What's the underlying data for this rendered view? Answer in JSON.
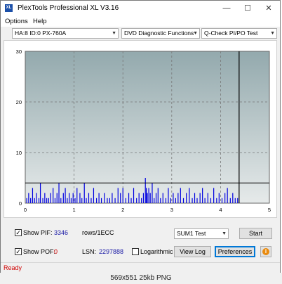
{
  "window": {
    "title": "PlexTools Professional XL V3.16",
    "icon_text": "XL",
    "minimize": "—",
    "maximize": "☐",
    "close": "✕"
  },
  "menu": {
    "options": "Options",
    "help": "Help"
  },
  "toolbar": {
    "drive": "HA:8 ID:0  PX-760A",
    "function": "DVD Diagnostic Functions",
    "test": "Q-Check PI/PO Test"
  },
  "chart_data": {
    "type": "bar",
    "xlim": [
      0,
      5
    ],
    "ylim": [
      0,
      30
    ],
    "x_ticks": [
      "0",
      "1",
      "2",
      "3",
      "4",
      "5"
    ],
    "y_ticks": [
      "0",
      "10",
      "20",
      "30"
    ],
    "threshold_y": 4,
    "end_marker_x": 4.38,
    "grid": true,
    "colors": {
      "bars": "#0000e0",
      "threshold": "#000000",
      "end_marker": "#000000"
    },
    "series": [
      {
        "x": [
          0.03,
          0.07,
          0.11,
          0.15,
          0.19,
          0.23,
          0.28,
          0.31,
          0.36,
          0.4,
          0.44,
          0.48,
          0.52,
          0.57,
          0.61,
          0.65,
          0.69,
          0.73,
          0.78,
          0.82,
          0.86,
          0.9,
          0.94,
          0.98,
          1.02,
          1.06,
          1.12,
          1.16,
          1.21,
          1.25,
          1.3,
          1.35,
          1.4,
          1.46,
          1.51,
          1.56,
          1.62,
          1.68,
          1.73,
          1.78,
          1.84,
          1.9,
          1.95,
          2.0,
          2.06,
          2.12,
          2.17,
          2.22,
          2.28,
          2.33,
          2.38,
          2.42,
          2.46,
          2.48,
          2.5,
          2.53,
          2.56,
          2.6,
          2.64,
          2.68,
          2.72,
          2.77,
          2.82,
          2.88,
          2.93,
          2.98,
          3.03,
          3.08,
          3.13,
          3.18,
          3.24,
          3.3,
          3.36,
          3.42,
          3.47,
          3.52,
          3.58,
          3.63,
          3.68,
          3.74,
          3.8,
          3.86,
          3.92,
          3.97,
          4.03,
          4.09,
          4.14,
          4.2,
          4.25,
          4.3,
          4.35
        ],
        "values": [
          1,
          2,
          1,
          3,
          1,
          2,
          1,
          4,
          1,
          2,
          1,
          1,
          2,
          3,
          1,
          2,
          4,
          1,
          2,
          3,
          1,
          2,
          1,
          2,
          1,
          3,
          2,
          1,
          4,
          1,
          2,
          1,
          3,
          1,
          2,
          1,
          2,
          1,
          1,
          2,
          1,
          3,
          2,
          3,
          1,
          2,
          1,
          3,
          1,
          2,
          1,
          2,
          5,
          3,
          2,
          3,
          2,
          4,
          1,
          2,
          3,
          1,
          2,
          1,
          3,
          1,
          2,
          1,
          2,
          3,
          1,
          2,
          3,
          1,
          2,
          1,
          2,
          3,
          1,
          2,
          1,
          3,
          1,
          2,
          1,
          2,
          3,
          1,
          2,
          1,
          1
        ]
      }
    ]
  },
  "controls": {
    "show_pif_label": "Show PIF:",
    "pif_value": "3346",
    "pif_unit": "rows/1ECC",
    "show_pof_label": "Show POF:",
    "pof_value": "0",
    "lsn_label": "LSN:",
    "lsn_value": "2297888",
    "logarithmic_label": "Logarithmic",
    "sum_select": "SUM1 Test",
    "start_button": "Start",
    "viewlog_button": "View Log",
    "preferences_button": "Preferences",
    "info_icon": "i",
    "show_pif_checked": "✓",
    "show_pof_checked": "✓"
  },
  "status": {
    "text": "Ready"
  },
  "caption": "569x551  25kb  PNG"
}
